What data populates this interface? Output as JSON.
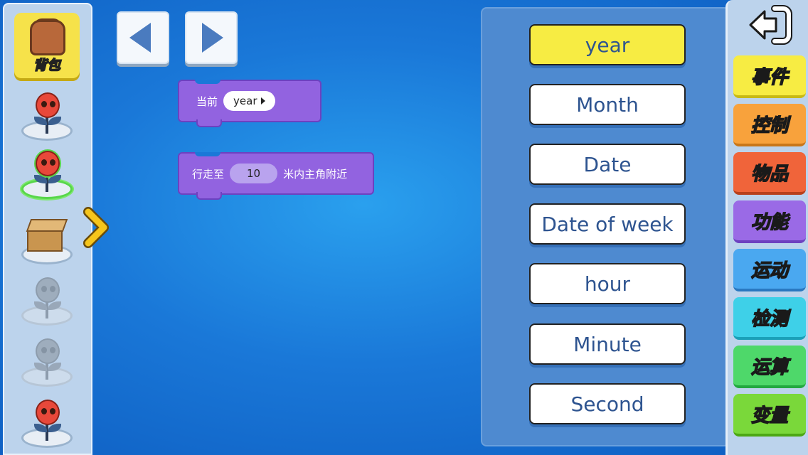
{
  "sidebar": {
    "bag_label": "背包",
    "characters": [
      {
        "type": "flower",
        "state": "normal"
      },
      {
        "type": "flower",
        "state": "selected"
      },
      {
        "type": "box",
        "state": "normal"
      },
      {
        "type": "flower",
        "state": "faded"
      },
      {
        "type": "flower",
        "state": "faded"
      },
      {
        "type": "flower",
        "state": "normal"
      }
    ]
  },
  "nav": {
    "back_icon": "arrow-left-icon",
    "forward_icon": "arrow-right-icon"
  },
  "blocks": {
    "current_time": {
      "label": "当前",
      "value": "year"
    },
    "walk_near": {
      "prefix": "行走至",
      "value": "10",
      "suffix": "米内主角附近"
    }
  },
  "options": {
    "items": [
      "year",
      "Month",
      "Date",
      "Date of week",
      "hour",
      "Minute",
      "Second"
    ],
    "selected": "year"
  },
  "categories": [
    {
      "label": "事件",
      "color": "#f7ec43",
      "border": "#c7b914"
    },
    {
      "label": "控制",
      "color": "#f8a23c",
      "border": "#c9771a"
    },
    {
      "label": "物品",
      "color": "#f0643a",
      "border": "#b8401c"
    },
    {
      "label": "功能",
      "color": "#9a6ae6",
      "border": "#6d41c0"
    },
    {
      "label": "运动",
      "color": "#4aa8f0",
      "border": "#2a78c0"
    },
    {
      "label": "检测",
      "color": "#3ed0e8",
      "border": "#1aa0b8"
    },
    {
      "label": "运算",
      "color": "#4ed86a",
      "border": "#22a840"
    },
    {
      "label": "变量",
      "color": "#7ad83a",
      "border": "#4ca814"
    }
  ],
  "colors": {
    "block_purple": "#9263e0",
    "selected_option": "#f7ec43",
    "option_text": "#2e5490"
  }
}
